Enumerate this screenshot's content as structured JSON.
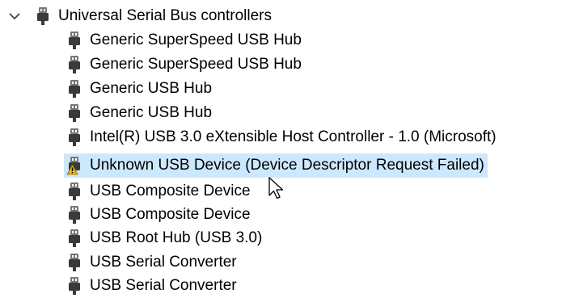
{
  "tree": {
    "category": {
      "label": "Universal Serial Bus controllers",
      "expanded": true,
      "icon": "usb-plug-icon"
    },
    "devices": [
      {
        "label": "Generic SuperSpeed USB Hub",
        "icon": "usb-plug-icon"
      },
      {
        "label": "Generic SuperSpeed USB Hub",
        "icon": "usb-plug-icon"
      },
      {
        "label": "Generic USB Hub",
        "icon": "usb-plug-icon"
      },
      {
        "label": "Generic USB Hub",
        "icon": "usb-plug-icon"
      },
      {
        "label": "Intel(R) USB 3.0 eXtensible Host Controller - 1.0 (Microsoft)",
        "icon": "usb-plug-icon"
      },
      {
        "label": "Unknown USB Device (Device Descriptor Request Failed)",
        "icon": "usb-warning-icon",
        "selected": true
      },
      {
        "label": "USB Composite Device",
        "icon": "usb-plug-icon"
      },
      {
        "label": "USB Composite Device",
        "icon": "usb-plug-icon"
      },
      {
        "label": "USB Root Hub (USB 3.0)",
        "icon": "usb-plug-icon"
      },
      {
        "label": "USB Serial Converter",
        "icon": "usb-plug-icon"
      },
      {
        "label": "USB Serial Converter",
        "icon": "usb-plug-icon"
      }
    ]
  },
  "colors": {
    "selection": "#cce8ff",
    "icon_dark": "#3a3a3a",
    "icon_mid": "#7a7a7a",
    "warning": "#f2b400"
  }
}
